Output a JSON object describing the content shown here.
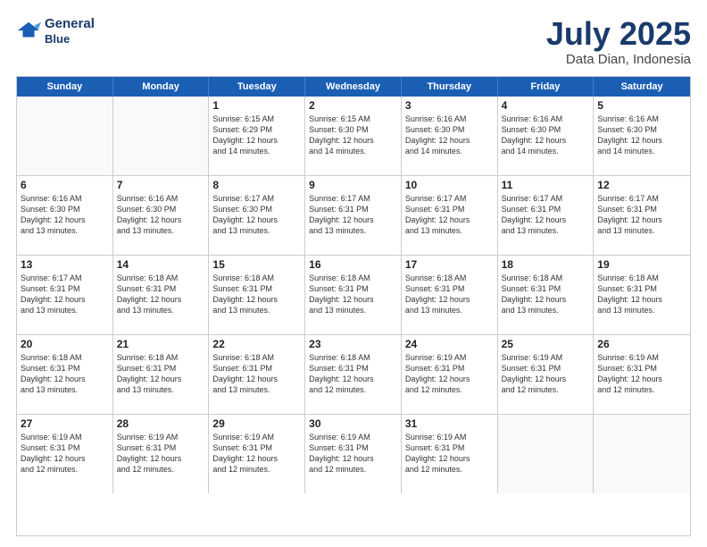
{
  "header": {
    "logo_line1": "General",
    "logo_line2": "Blue",
    "title": "July 2025",
    "subtitle": "Data Dian, Indonesia"
  },
  "days_of_week": [
    "Sunday",
    "Monday",
    "Tuesday",
    "Wednesday",
    "Thursday",
    "Friday",
    "Saturday"
  ],
  "weeks": [
    [
      {
        "day": "",
        "text": ""
      },
      {
        "day": "",
        "text": ""
      },
      {
        "day": "1",
        "text": "Sunrise: 6:15 AM\nSunset: 6:29 PM\nDaylight: 12 hours\nand 14 minutes."
      },
      {
        "day": "2",
        "text": "Sunrise: 6:15 AM\nSunset: 6:30 PM\nDaylight: 12 hours\nand 14 minutes."
      },
      {
        "day": "3",
        "text": "Sunrise: 6:16 AM\nSunset: 6:30 PM\nDaylight: 12 hours\nand 14 minutes."
      },
      {
        "day": "4",
        "text": "Sunrise: 6:16 AM\nSunset: 6:30 PM\nDaylight: 12 hours\nand 14 minutes."
      },
      {
        "day": "5",
        "text": "Sunrise: 6:16 AM\nSunset: 6:30 PM\nDaylight: 12 hours\nand 14 minutes."
      }
    ],
    [
      {
        "day": "6",
        "text": "Sunrise: 6:16 AM\nSunset: 6:30 PM\nDaylight: 12 hours\nand 13 minutes."
      },
      {
        "day": "7",
        "text": "Sunrise: 6:16 AM\nSunset: 6:30 PM\nDaylight: 12 hours\nand 13 minutes."
      },
      {
        "day": "8",
        "text": "Sunrise: 6:17 AM\nSunset: 6:30 PM\nDaylight: 12 hours\nand 13 minutes."
      },
      {
        "day": "9",
        "text": "Sunrise: 6:17 AM\nSunset: 6:31 PM\nDaylight: 12 hours\nand 13 minutes."
      },
      {
        "day": "10",
        "text": "Sunrise: 6:17 AM\nSunset: 6:31 PM\nDaylight: 12 hours\nand 13 minutes."
      },
      {
        "day": "11",
        "text": "Sunrise: 6:17 AM\nSunset: 6:31 PM\nDaylight: 12 hours\nand 13 minutes."
      },
      {
        "day": "12",
        "text": "Sunrise: 6:17 AM\nSunset: 6:31 PM\nDaylight: 12 hours\nand 13 minutes."
      }
    ],
    [
      {
        "day": "13",
        "text": "Sunrise: 6:17 AM\nSunset: 6:31 PM\nDaylight: 12 hours\nand 13 minutes."
      },
      {
        "day": "14",
        "text": "Sunrise: 6:18 AM\nSunset: 6:31 PM\nDaylight: 12 hours\nand 13 minutes."
      },
      {
        "day": "15",
        "text": "Sunrise: 6:18 AM\nSunset: 6:31 PM\nDaylight: 12 hours\nand 13 minutes."
      },
      {
        "day": "16",
        "text": "Sunrise: 6:18 AM\nSunset: 6:31 PM\nDaylight: 12 hours\nand 13 minutes."
      },
      {
        "day": "17",
        "text": "Sunrise: 6:18 AM\nSunset: 6:31 PM\nDaylight: 12 hours\nand 13 minutes."
      },
      {
        "day": "18",
        "text": "Sunrise: 6:18 AM\nSunset: 6:31 PM\nDaylight: 12 hours\nand 13 minutes."
      },
      {
        "day": "19",
        "text": "Sunrise: 6:18 AM\nSunset: 6:31 PM\nDaylight: 12 hours\nand 13 minutes."
      }
    ],
    [
      {
        "day": "20",
        "text": "Sunrise: 6:18 AM\nSunset: 6:31 PM\nDaylight: 12 hours\nand 13 minutes."
      },
      {
        "day": "21",
        "text": "Sunrise: 6:18 AM\nSunset: 6:31 PM\nDaylight: 12 hours\nand 13 minutes."
      },
      {
        "day": "22",
        "text": "Sunrise: 6:18 AM\nSunset: 6:31 PM\nDaylight: 12 hours\nand 13 minutes."
      },
      {
        "day": "23",
        "text": "Sunrise: 6:18 AM\nSunset: 6:31 PM\nDaylight: 12 hours\nand 12 minutes."
      },
      {
        "day": "24",
        "text": "Sunrise: 6:19 AM\nSunset: 6:31 PM\nDaylight: 12 hours\nand 12 minutes."
      },
      {
        "day": "25",
        "text": "Sunrise: 6:19 AM\nSunset: 6:31 PM\nDaylight: 12 hours\nand 12 minutes."
      },
      {
        "day": "26",
        "text": "Sunrise: 6:19 AM\nSunset: 6:31 PM\nDaylight: 12 hours\nand 12 minutes."
      }
    ],
    [
      {
        "day": "27",
        "text": "Sunrise: 6:19 AM\nSunset: 6:31 PM\nDaylight: 12 hours\nand 12 minutes."
      },
      {
        "day": "28",
        "text": "Sunrise: 6:19 AM\nSunset: 6:31 PM\nDaylight: 12 hours\nand 12 minutes."
      },
      {
        "day": "29",
        "text": "Sunrise: 6:19 AM\nSunset: 6:31 PM\nDaylight: 12 hours\nand 12 minutes."
      },
      {
        "day": "30",
        "text": "Sunrise: 6:19 AM\nSunset: 6:31 PM\nDaylight: 12 hours\nand 12 minutes."
      },
      {
        "day": "31",
        "text": "Sunrise: 6:19 AM\nSunset: 6:31 PM\nDaylight: 12 hours\nand 12 minutes."
      },
      {
        "day": "",
        "text": ""
      },
      {
        "day": "",
        "text": ""
      }
    ]
  ]
}
